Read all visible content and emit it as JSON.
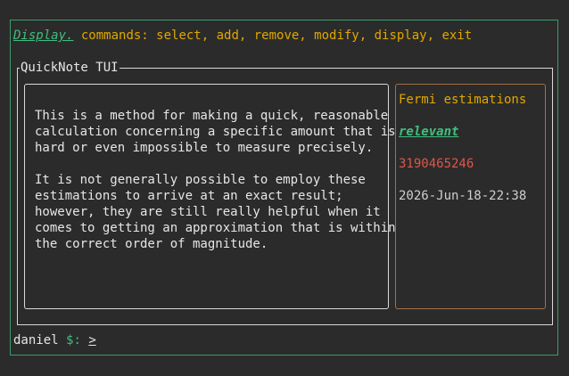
{
  "header": {
    "mode_label": "Display.",
    "commands_text": "commands: select, add, remove, modify, display, exit"
  },
  "panel": {
    "title": "QuickNote TUI"
  },
  "note": {
    "body": "This is a method for making a quick, reasonable\ncalculation concerning a specific amount that is\nhard or even impossible to measure precisely.\n\nIt is not generally possible to employ these\nestimations to arrive at an exact result;\nhowever, they are still really helpful when it\ncomes to getting an approximation that is within\nthe correct order of magnitude.",
    "title": "Fermi estimations",
    "tag": "relevant",
    "id": "3190465246",
    "date": "2026-Jun-18-22:38"
  },
  "prompt": {
    "user": "daniel",
    "symbol": "$:",
    "cursor": ">"
  },
  "colors": {
    "accent_green": "#3fbf7f",
    "accent_yellow": "#e0a800",
    "accent_red": "#e0554a",
    "meta_border": "#a3714a",
    "outer_border": "#3f9a6e"
  }
}
